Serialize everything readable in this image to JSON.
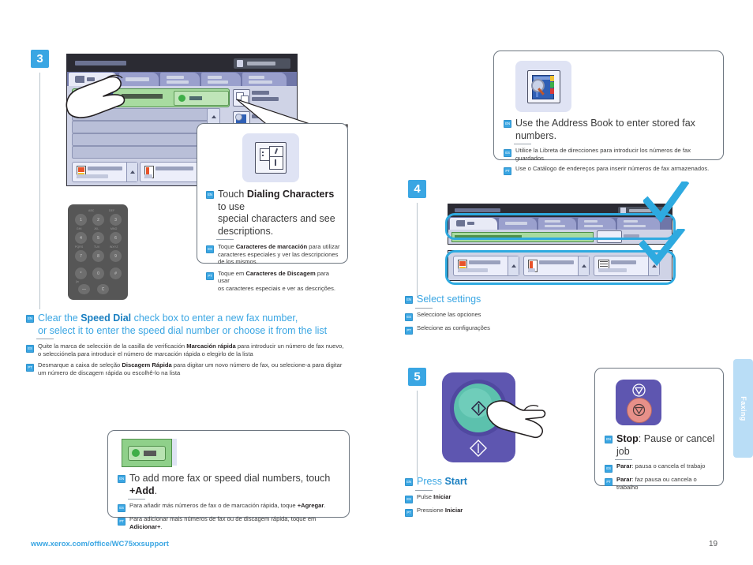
{
  "document": {
    "footer_url": "www.xerox.com/office/WC75xxsupport",
    "page_number": "19",
    "side_tab_label": "Faxing",
    "accent_blue": "#3aa6e3",
    "text_dark": "#231f20"
  },
  "languages": {
    "en": "EN",
    "es": "ES",
    "pt": "PT"
  },
  "steps": {
    "step3": {
      "number": "3"
    },
    "step4": {
      "number": "4",
      "en": "Select settings",
      "es": "Seleccione las opciones",
      "pt": "Selecione as configurações"
    },
    "step5": {
      "number": "5",
      "en_pre": "Press ",
      "en_bold": "Start",
      "es_pre": "Pulse ",
      "es_bold": "Iniciar",
      "pt_pre": "Pressione ",
      "pt_bold": "Iniciar"
    }
  },
  "callouts": {
    "dialing_characters": {
      "icon": "dialing-characters-icon",
      "en_1": "Touch ",
      "en_bold": "Dialing Characters",
      "en_2": " to use",
      "en_3": "special characters and see descriptions.",
      "es_1": "Toque ",
      "es_bold": "Caracteres de marcación",
      "es_2": " para utilizar",
      "es_3": "caracteres especiales y ver las descripciones",
      "es_4": "de los mismos.",
      "pt_1": "Toque em ",
      "pt_bold": "Caracteres de Discagem",
      "pt_2": " para usar",
      "pt_3": "os caracteres especiais e ver as descrições."
    },
    "address_book": {
      "icon": "address-book-icon",
      "en": "Use the Address Book to enter stored fax numbers.",
      "es": "Utilice la Libreta de direcciones para introducir los números de fax guardados.",
      "pt": "Use o Catálogo de endereços para inserir números de fax armazenados."
    },
    "add_button": {
      "icon": "add-fax-number-button",
      "en_1": "To add more fax or speed dial  numbers, touch ",
      "en_bold": "+Add",
      "en_2": ".",
      "es_1": "Para añadir más números de fax o de marcación rápida, toque ",
      "es_bold": "+Agregar",
      "es_2": ".",
      "pt_1": "Para adicionar mais números de fax ou de discagem rápida, toque em ",
      "pt_bold": "Adicionar+",
      "pt_2": "."
    },
    "stop": {
      "icon": "stop-button-icon",
      "en_bold": "Stop",
      "en_rest": ": Pause or cancel job",
      "es_bold": "Parar",
      "es_rest": ": pausa o cancela el trabajo",
      "pt_bold": "Parar",
      "pt_rest": ": faz pausa ou cancela o trabalho"
    }
  },
  "body_text": {
    "speed_dial": {
      "en_1": "Clear the ",
      "en_bold": "Speed Dial",
      "en_2": " check box to enter a new fax number,",
      "en_3": "or select it to enter the speed dial number or choose it from the list",
      "es_1": "Quite la marca de selección de la casilla de verificación ",
      "es_bold": "Marcación rápida",
      "es_2": " para introducir un número de fax nuevo,",
      "es_3": "o selecciónela para introducir el número de marcación rápida o elegirlo de la lista",
      "pt_1": "Desmarque a caixa de seleção ",
      "pt_bold": "Discagem Rápida",
      "pt_2": " para digitar um novo número de fax, ou selecione-a para digitar",
      "pt_3": "um número de discagem rápida ou escolhê-lo na lista"
    }
  },
  "keypad": {
    "keys": [
      "1",
      "2",
      "3",
      "4",
      "5",
      "6",
      "7",
      "8",
      "9",
      "*",
      "0",
      "#"
    ],
    "letters": [
      "",
      "ABC",
      "DEF",
      "GHI",
      "JKL",
      "MNO",
      "PQRS",
      "TUV",
      "WXYZ"
    ],
    "extra_keys": [
      "—",
      "C"
    ]
  }
}
